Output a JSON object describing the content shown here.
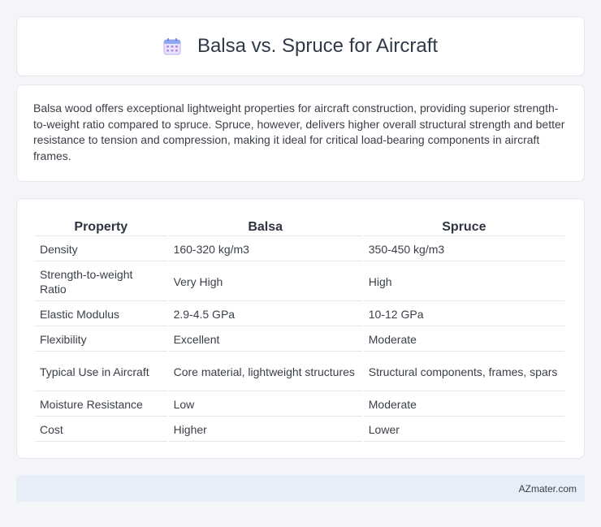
{
  "header": {
    "title": "Balsa vs. Spruce for Aircraft",
    "icon": "calendar-icon"
  },
  "intro": {
    "text": "Balsa wood offers exceptional lightweight properties for aircraft construction, providing superior strength-to-weight ratio compared to spruce. Spruce, however, delivers higher overall structural strength and better resistance to tension and compression, making it ideal for critical load-bearing components in aircraft frames."
  },
  "table": {
    "headers": [
      "Property",
      "Balsa",
      "Spruce"
    ],
    "rows": [
      [
        "Density",
        "160-320 kg/m3",
        "350-450 kg/m3"
      ],
      [
        "Strength-to-weight Ratio",
        "Very High",
        "High"
      ],
      [
        "Elastic Modulus",
        "2.9-4.5 GPa",
        "10-12 GPa"
      ],
      [
        "Flexibility",
        "Excellent",
        "Moderate"
      ],
      [
        "Typical Use in Aircraft",
        "Core material, lightweight structures",
        "Structural components, frames, spars"
      ],
      [
        "Moisture Resistance",
        "Low",
        "Moderate"
      ],
      [
        "Cost",
        "Higher",
        "Lower"
      ]
    ]
  },
  "footer": {
    "text": "AZmater.com"
  },
  "colors": {
    "background": "#f3f5f8",
    "card": "#ffffff",
    "footer": "#e8eef7",
    "title": "#2f3a48"
  }
}
